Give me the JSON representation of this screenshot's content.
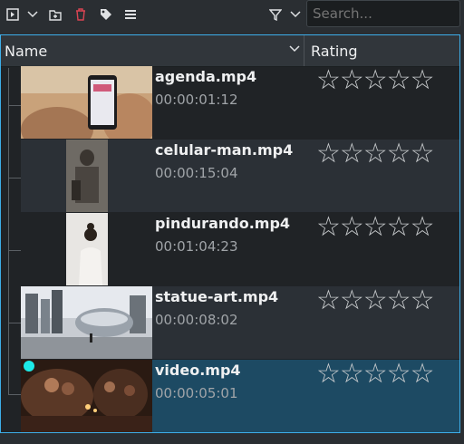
{
  "toolbar": {
    "icons": [
      "preview-panel-icon",
      "chevron-down-icon",
      "add-folder-icon",
      "trash-icon",
      "tag-icon",
      "menu-icon",
      "filter-icon",
      "chevron-down-icon"
    ],
    "search_placeholder": "Search..."
  },
  "list": {
    "columns": [
      "Name",
      "Rating"
    ],
    "rows": [
      {
        "title": "agenda.mp4",
        "duration": "00:00:01:12",
        "rating_stars": "☆☆☆☆☆"
      },
      {
        "title": "celular-man.mp4",
        "duration": "00:00:15:04",
        "rating_stars": "☆☆☆☆☆"
      },
      {
        "title": "pindurando.mp4",
        "duration": "00:01:04:23",
        "rating_stars": "☆☆☆☆☆"
      },
      {
        "title": "statue-art.mp4",
        "duration": "00:00:08:02",
        "rating_stars": "☆☆☆☆☆"
      },
      {
        "title": "video.mp4",
        "duration": "00:00:05:01",
        "rating_stars": "☆☆☆☆☆"
      }
    ]
  },
  "colors": {
    "accent": "#3daee9",
    "selected_row": "#1d4a63",
    "alt_row": "#2b3036",
    "marker": "#1de9e6",
    "trash": "#da4453"
  }
}
